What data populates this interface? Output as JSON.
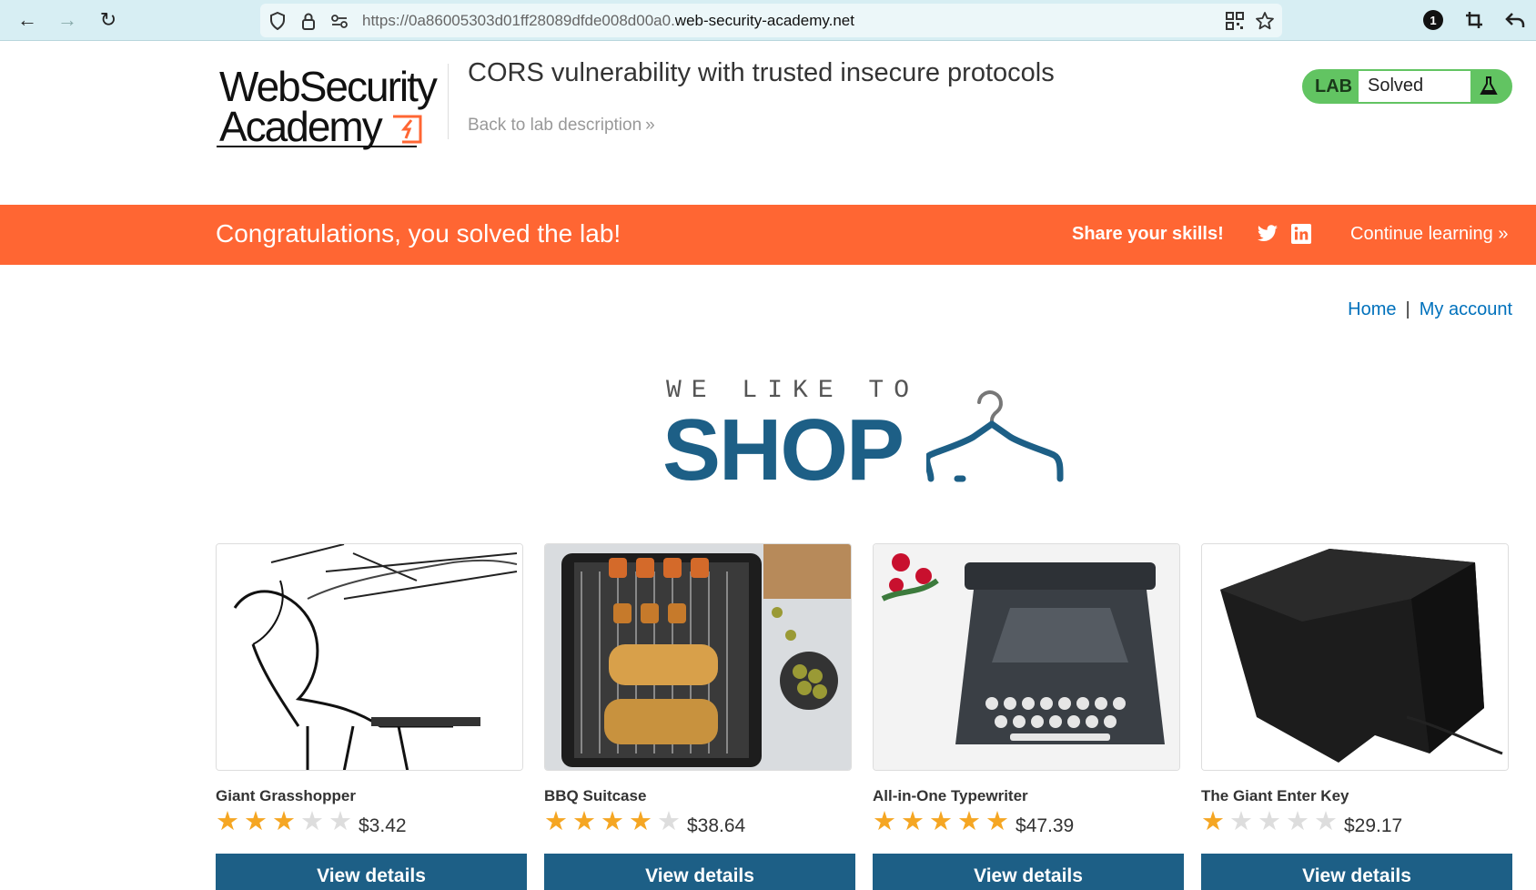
{
  "browser": {
    "url_prefix": "https://0a86005303d01ff28089dfde008d00a0.",
    "url_host": "web-security-academy.net",
    "badge_count": "1"
  },
  "header": {
    "logo_line1": "WebSecurity",
    "logo_line2": "Academy",
    "lab_title": "CORS vulnerability with trusted insecure protocols",
    "back_link": "Back to lab description",
    "lab_label": "LAB",
    "lab_status": "Solved"
  },
  "banner": {
    "message": "Congratulations, you solved the lab!",
    "share": "Share your skills!",
    "continue": "Continue learning"
  },
  "nav": {
    "home": "Home",
    "separator": "|",
    "account": "My account"
  },
  "hero": {
    "top": "WE LIKE TO",
    "main": "SHOP"
  },
  "products": [
    {
      "name": "Giant Grasshopper",
      "rating": 3,
      "price": "$3.42",
      "button": "View details"
    },
    {
      "name": "BBQ Suitcase",
      "rating": 4,
      "price": "$38.64",
      "button": "View details"
    },
    {
      "name": "All-in-One Typewriter",
      "rating": 5,
      "price": "$47.39",
      "button": "View details"
    },
    {
      "name": "The Giant Enter Key",
      "rating": 1,
      "price": "$29.17",
      "button": "View details"
    }
  ],
  "colors": {
    "banner": "#ff6633",
    "brand_blue": "#1d5f86",
    "link": "#0071bc",
    "lab_green": "#62c462",
    "star": "#f5a623"
  }
}
